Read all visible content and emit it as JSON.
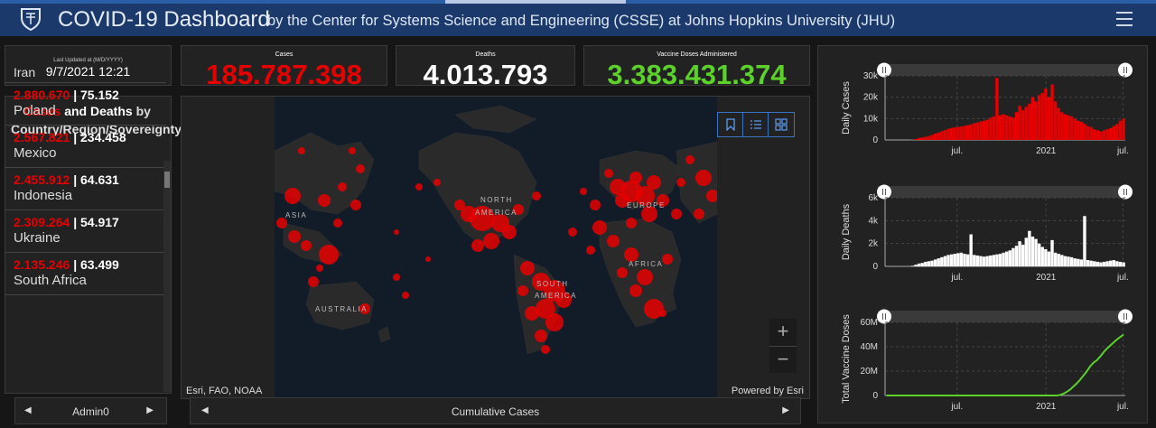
{
  "header": {
    "title": "COVID-19 Dashboard",
    "subtitle": "by the Center for Systems Science and Engineering (CSSE) at Johns Hopkins University (JHU)"
  },
  "updated": {
    "label": "Last Updated at (M/D/YYYY)",
    "value": "9/7/2021 12:21"
  },
  "counters": {
    "cases": {
      "label": "Cases",
      "value": "185.787.398",
      "color": "#e60000"
    },
    "deaths": {
      "label": "Deaths",
      "value": "4.013.793",
      "color": "#ffffff"
    },
    "vaccines": {
      "label": "Vaccine Doses Administered",
      "value": "3.383.431.374",
      "color": "#5bd12a"
    }
  },
  "country_list": {
    "title_cases": "Cases",
    "title_and": "and",
    "title_deaths": "Deaths",
    "title_rest": "by Country/Region/Sovereignty",
    "partial_item": "Iran",
    "rows": [
      {
        "cases": "2.880.670",
        "deaths": "75.152",
        "name": "Poland"
      },
      {
        "cases": "2.567.821",
        "deaths": "234.458",
        "name": "Mexico"
      },
      {
        "cases": "2.455.912",
        "deaths": "64.631",
        "name": "Indonesia"
      },
      {
        "cases": "2.309.264",
        "deaths": "54.917",
        "name": "Ukraine"
      },
      {
        "cases": "2.135.246",
        "deaths": "63.499",
        "name": "South Africa"
      }
    ],
    "separator": "|"
  },
  "left_pager": {
    "label": "Admin0"
  },
  "map": {
    "labels": {
      "asia": "ASIA",
      "north_america_1": "NORTH",
      "north_america_2": "AMERICA",
      "europe": "EUROPE",
      "africa": "AFRICA",
      "south_america_1": "SOUTH",
      "south_america_2": "AMERICA",
      "australia": "AUSTRALIA"
    },
    "attribution_left": "Esri, FAO, NOAA",
    "attribution_right": "Powered by Esri",
    "zoom_in": "+",
    "zoom_out": "−",
    "tool_icons": [
      "bookmark-icon",
      "legend-list-icon",
      "basemap-gallery-icon"
    ],
    "bubble_color": "#e60000"
  },
  "map_pager": {
    "label": "Cumulative Cases"
  },
  "chart_data": [
    {
      "type": "bar",
      "ylabel": "Daily Cases",
      "yticks": [
        "0",
        "10k",
        "20k",
        "30k"
      ],
      "ylim": [
        0,
        32000
      ],
      "xticks": [
        "jul.",
        "2021",
        "jul."
      ],
      "color": "#e60000",
      "x_start": "2020-01-22",
      "x_end": "2021-09-07",
      "series": [
        {
          "values": [
            0,
            0,
            0,
            0,
            0,
            0,
            0,
            0,
            100,
            400,
            900,
            1200,
            1500,
            1800,
            2400,
            2900,
            3500,
            4100,
            4600,
            5200,
            5600,
            5900,
            6100,
            6300,
            6600,
            6900,
            7300,
            7800,
            8200,
            8600,
            9000,
            9500,
            10400,
            11000,
            29000,
            11600,
            12000,
            11500,
            11000,
            10500,
            13000,
            16000,
            14000,
            15500,
            17000,
            20000,
            18000,
            21000,
            22000,
            24000,
            20000,
            26000,
            18000,
            15000,
            13000,
            12000,
            11500,
            11000,
            10000,
            9000,
            8500,
            7500,
            6500,
            6000,
            5000,
            4500,
            4000,
            4500,
            5000,
            5500,
            6500,
            7500,
            9000,
            10000
          ]
        }
      ]
    },
    {
      "type": "bar",
      "ylabel": "Daily Deaths",
      "yticks": [
        "0",
        "2k",
        "4k",
        "6k"
      ],
      "ylim": [
        0,
        6500
      ],
      "xticks": [
        "jul.",
        "2021",
        "jul."
      ],
      "color": "#ffffff",
      "series": [
        {
          "values": [
            0,
            0,
            0,
            0,
            0,
            0,
            0,
            0,
            50,
            150,
            250,
            300,
            400,
            450,
            500,
            600,
            700,
            800,
            900,
            1000,
            1050,
            1100,
            1150,
            1200,
            1100,
            1050,
            2800,
            1000,
            950,
            900,
            850,
            900,
            950,
            1000,
            1050,
            1100,
            1200,
            1300,
            1400,
            1600,
            1800,
            2200,
            1900,
            2500,
            3100,
            2600,
            2400,
            2000,
            1700,
            1500,
            1300,
            2300,
            1200,
            1100,
            1000,
            900,
            850,
            800,
            700,
            650,
            600,
            4400,
            550,
            500,
            450,
            400,
            350,
            400,
            450,
            500,
            550,
            450,
            400,
            350
          ]
        }
      ]
    },
    {
      "type": "line",
      "ylabel": "Total Vaccine Doses",
      "yticks": [
        "0",
        "20M",
        "40M",
        "60M"
      ],
      "ylim": [
        0,
        62000000
      ],
      "xticks": [
        "jul.",
        "2021",
        "jul."
      ],
      "color": "#5bd12a",
      "series": [
        {
          "values": [
            0,
            0,
            0,
            0,
            0,
            0,
            0,
            0,
            0,
            0,
            0,
            0,
            0,
            0,
            0,
            0,
            0,
            0,
            0,
            0,
            0,
            0,
            0,
            0,
            0,
            0,
            0,
            0,
            0,
            0,
            0,
            0,
            0,
            0,
            0,
            0,
            0,
            0,
            0,
            0,
            0,
            0,
            0,
            0,
            0,
            0,
            0,
            0,
            0,
            0,
            0,
            0,
            500000,
            1500000,
            3000000,
            5000000,
            7500000,
            10000000,
            13000000,
            16500000,
            20000000,
            24000000,
            27000000,
            29000000,
            32000000,
            35500000,
            38500000,
            41000000,
            43500000,
            46000000,
            48000000,
            50000000
          ]
        }
      ]
    }
  ]
}
